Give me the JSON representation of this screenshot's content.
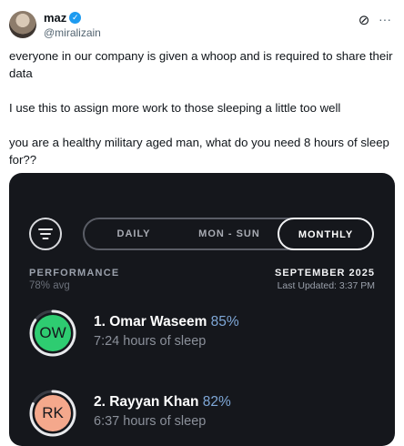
{
  "post": {
    "author": {
      "name": "maz",
      "handle": "@miralizain",
      "verified": true
    },
    "paragraphs": [
      "everyone in our company is given a whoop and is required to share their data",
      "I use this to assign more work to those sleeping a little too well",
      "you are a healthy military aged man, what do you need 8 hours of sleep for??"
    ],
    "icons": {
      "grok": "grok-icon",
      "more": "more-options-icon",
      "verified": "verified-badge-icon"
    }
  },
  "app": {
    "tabs": {
      "daily": "DAILY",
      "week": "MON - SUN",
      "monthly": "MONTHLY",
      "selected": "monthly"
    },
    "performance": {
      "label": "PERFORMANCE",
      "avg": "78% avg"
    },
    "period": {
      "label": "SEPTEMBER 2025",
      "updated": "Last Updated: 3:37 PM"
    },
    "people": [
      {
        "initials": "OW",
        "name": "1. Omar Waseem",
        "percent": "85%",
        "percent_value": 0.85,
        "sleep": "7:24 hours of sleep",
        "color": "#2ecc71"
      },
      {
        "initials": "RK",
        "name": "2. Rayyan  Khan",
        "percent": "82%",
        "percent_value": 0.82,
        "sleep": "6:37 hours of sleep",
        "color": "#f4a88c"
      }
    ],
    "colors": {
      "background": "#15171c",
      "accent": "#7fa8d8"
    }
  }
}
